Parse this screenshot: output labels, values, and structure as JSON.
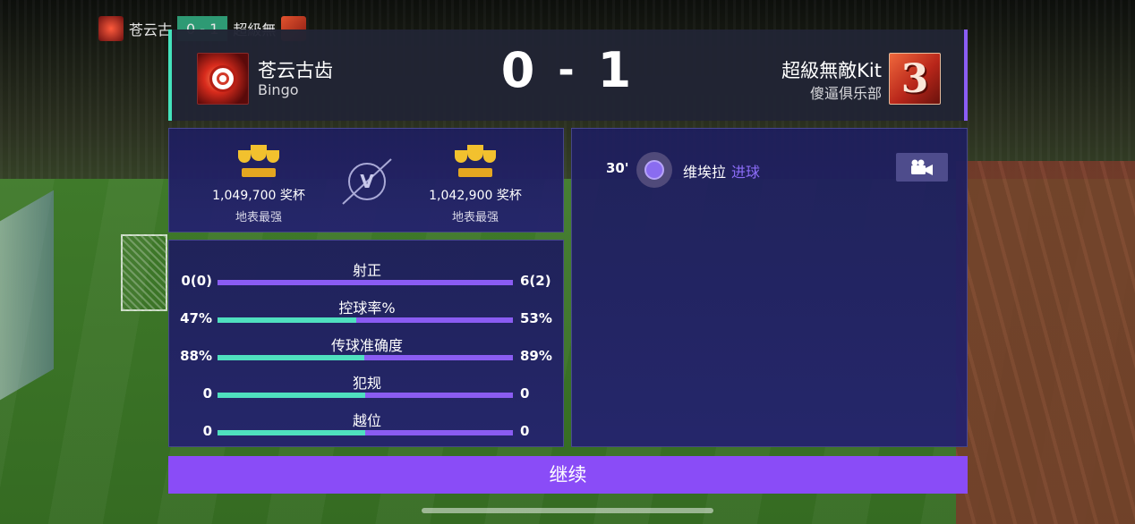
{
  "mini_scoreboard": {
    "home": "苍云古",
    "score": "0 - 1",
    "away": "超級無"
  },
  "header": {
    "home_team": {
      "name": "苍云古齿",
      "sub": "Bingo",
      "badge_icon": "soccer-ball-icon"
    },
    "away_team": {
      "name": "超級無敵Kit",
      "sub": "傻逼俱乐部",
      "badge_number": "3"
    },
    "score": {
      "home": "0",
      "separator": "-",
      "away": "1"
    }
  },
  "trophies": {
    "home": {
      "count": "1,049,700 奖杯",
      "rank": "地表最强"
    },
    "away": {
      "count": "1,042,900 奖杯",
      "rank": "地表最强"
    },
    "versus": "V"
  },
  "stats": [
    {
      "label": "射正",
      "home": "0(0)",
      "away": "6(2)",
      "home_share": 0.0
    },
    {
      "label": "控球率%",
      "home": "47%",
      "away": "53%",
      "home_share": 0.47
    },
    {
      "label": "传球准确度",
      "home": "88%",
      "away": "89%",
      "home_share": 0.497
    },
    {
      "label": "犯规",
      "home": "0",
      "away": "0",
      "home_share": 0.5
    },
    {
      "label": "越位",
      "home": "0",
      "away": "0",
      "home_share": 0.5
    }
  ],
  "events": [
    {
      "minute": "30'",
      "player": "维埃拉",
      "type": "进球"
    }
  ],
  "continue_label": "继续",
  "colors": {
    "accent_teal": "#4fe0bf",
    "accent_purple": "#8a4cf7",
    "trophy_gold": "#f2c12e"
  }
}
